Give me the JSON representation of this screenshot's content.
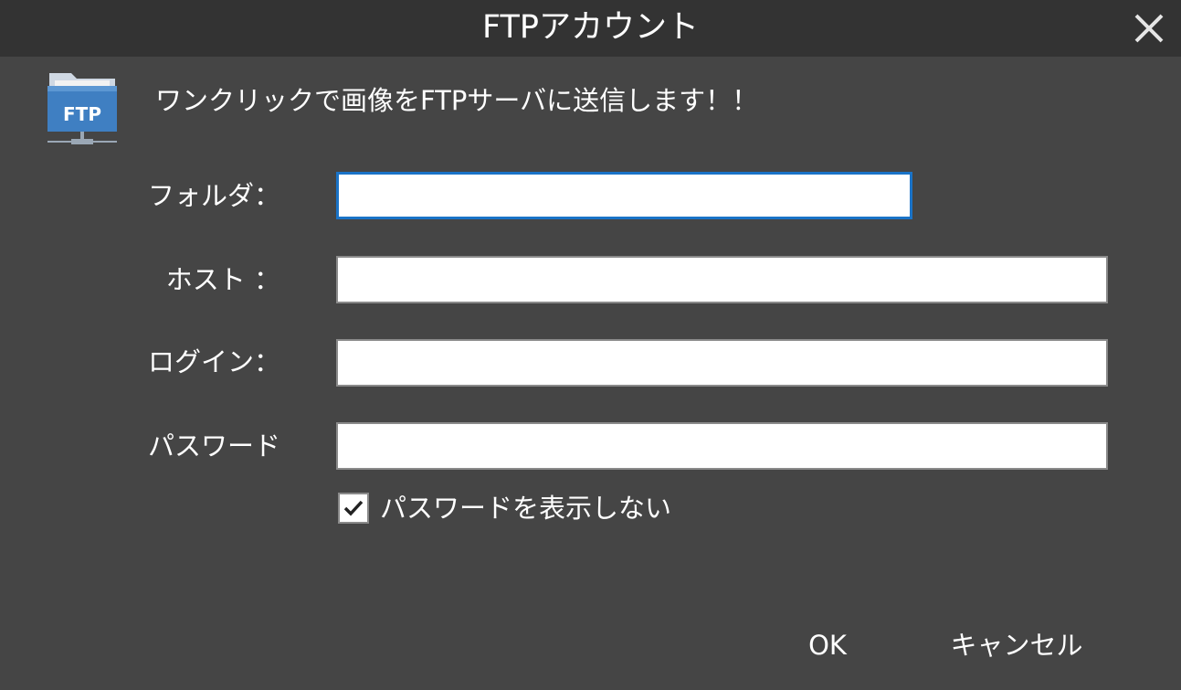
{
  "dialog": {
    "title": "FTPアカウント",
    "headline": "ワンクリックで画像をFTPサーバに送信します！！",
    "icon_text": "FTP"
  },
  "form": {
    "folder_label": "フォルダ：",
    "folder_value": "",
    "host_label": "ホスト ：",
    "host_value": "",
    "login_label": "ログイン：",
    "login_value": "",
    "password_label": "パスワード",
    "password_value": "",
    "hide_password_label": "パスワードを表示しない",
    "hide_password_checked": true
  },
  "buttons": {
    "ok_label": "OK",
    "cancel_label": "キャンセル"
  },
  "colors": {
    "background": "#454545",
    "titlebar": "#333333",
    "focus_border": "#1a73c7",
    "icon_blue": "#3f7fc2"
  }
}
